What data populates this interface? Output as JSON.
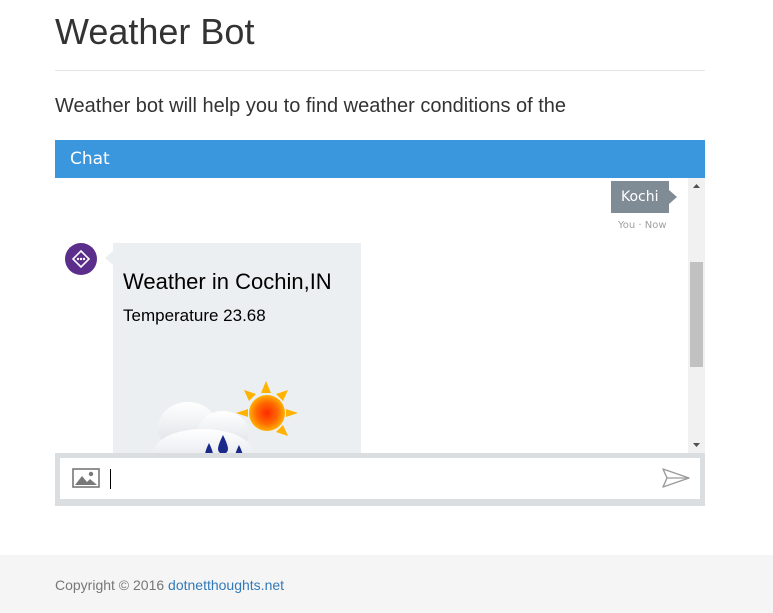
{
  "page": {
    "title": "Weather Bot",
    "intro": "Weather bot will help you to find weather conditions of the"
  },
  "chat": {
    "header_label": "Chat",
    "user_message": {
      "text": "Kochi",
      "timestamp": "You · Now"
    },
    "bot_card": {
      "title": "Weather in Cochin,IN",
      "text": "Temperature 23.68",
      "image_icon": "partly-cloudy-rain-icon"
    },
    "input": {
      "value": "",
      "placeholder": ""
    }
  },
  "footer": {
    "copyright": "Copyright © 2016",
    "link_text": "dotnetthoughts.net"
  },
  "colors": {
    "chat_header": "#3a96dd",
    "user_bubble": "#808c95",
    "bot_avatar": "#5b2e8c",
    "bot_card": "#eceff1",
    "link": "#337ab7"
  }
}
